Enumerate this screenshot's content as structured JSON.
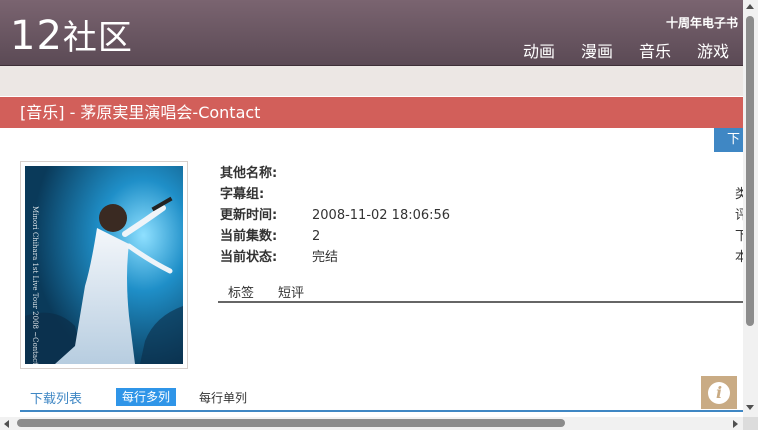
{
  "header": {
    "logo_num": "12",
    "logo_text": "社区",
    "top_link": "十周年电子书",
    "nav": [
      "动画",
      "漫画",
      "音乐",
      "游戏"
    ]
  },
  "title_bar": "[音乐] - 茅原実里演唱会-Contact",
  "download_button": "下",
  "details": [
    {
      "label": "其他名称:",
      "value": ""
    },
    {
      "label": "字幕组:",
      "value": ""
    },
    {
      "label": "更新时间:",
      "value": "2008-11-02 18:06:56"
    },
    {
      "label": "当前集数:",
      "value": "2"
    },
    {
      "label": "当前状态:",
      "value": "完结"
    }
  ],
  "right_col": [
    "类",
    "评",
    "下",
    "本"
  ],
  "tabs": [
    "标签",
    "短评"
  ],
  "list": {
    "title": "下载列表",
    "mode_multi": "每行多列",
    "mode_single": "每行单列"
  },
  "cover": {
    "text": "Minori Chihara 1st Live Tour 2008 ~Contact~"
  },
  "colors": {
    "header": "#6b5560",
    "title_bar": "#d25f5a",
    "accent": "#3f87c4",
    "info_button": "#c9ab84"
  }
}
